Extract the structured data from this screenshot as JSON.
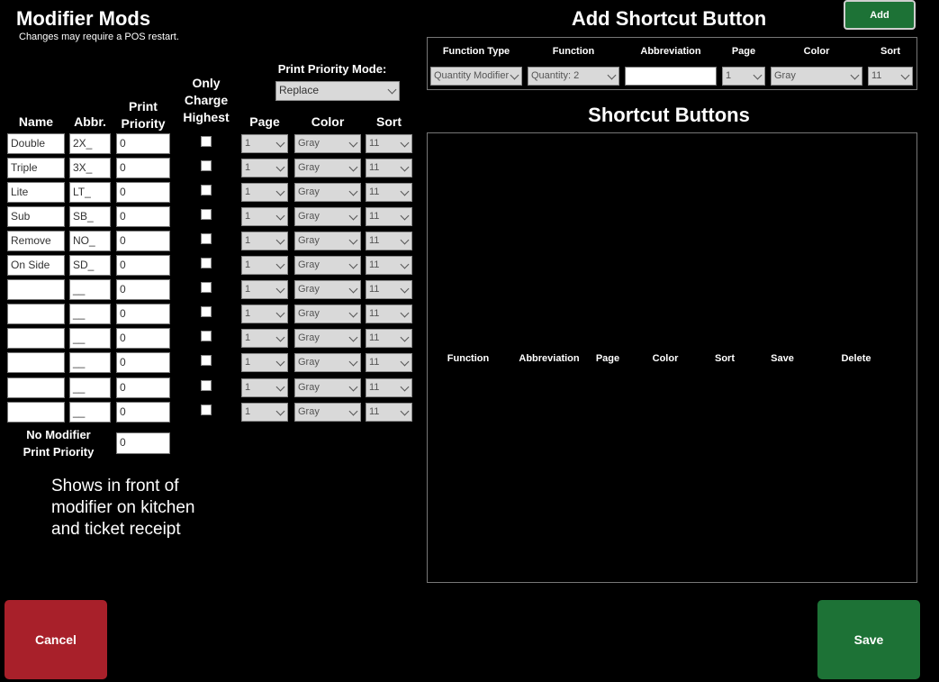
{
  "page": {
    "title": "Modifier Mods",
    "subtitle": "Changes may require a POS restart."
  },
  "mods": {
    "print_priority_mode_label": "Print Priority Mode:",
    "print_priority_mode_value": "Replace",
    "headers": {
      "name": "Name",
      "abbr": "Abbr.",
      "print_priority": "Print Priority",
      "only_charge_highest": "Only Charge Highest",
      "page": "Page",
      "color": "Color",
      "sort": "Sort"
    },
    "rows": [
      {
        "name": "Double",
        "abbr": "2X_",
        "priority": "0",
        "page": "1",
        "color": "Gray",
        "sort": "11"
      },
      {
        "name": "Triple",
        "abbr": "3X_",
        "priority": "0",
        "page": "1",
        "color": "Gray",
        "sort": "11"
      },
      {
        "name": "Lite",
        "abbr": "LT_",
        "priority": "0",
        "page": "1",
        "color": "Gray",
        "sort": "11"
      },
      {
        "name": "Sub",
        "abbr": "SB_",
        "priority": "0",
        "page": "1",
        "color": "Gray",
        "sort": "11"
      },
      {
        "name": "Remove",
        "abbr": "NO_",
        "priority": "0",
        "page": "1",
        "color": "Gray",
        "sort": "11"
      },
      {
        "name": "On Side",
        "abbr": "SD_",
        "priority": "0",
        "page": "1",
        "color": "Gray",
        "sort": "11"
      },
      {
        "name": "",
        "abbr": "__",
        "priority": "0",
        "page": "1",
        "color": "Gray",
        "sort": "11"
      },
      {
        "name": "",
        "abbr": "__",
        "priority": "0",
        "page": "1",
        "color": "Gray",
        "sort": "11"
      },
      {
        "name": "",
        "abbr": "__",
        "priority": "0",
        "page": "1",
        "color": "Gray",
        "sort": "11"
      },
      {
        "name": "",
        "abbr": "__",
        "priority": "0",
        "page": "1",
        "color": "Gray",
        "sort": "11"
      },
      {
        "name": "",
        "abbr": "__",
        "priority": "0",
        "page": "1",
        "color": "Gray",
        "sort": "11"
      },
      {
        "name": "",
        "abbr": "__",
        "priority": "0",
        "page": "1",
        "color": "Gray",
        "sort": "11"
      }
    ],
    "no_modifier_label": "No Modifier Print Priority",
    "no_modifier_value": "0",
    "note": "Shows in front of modifier on kitchen and ticket receipt"
  },
  "add_shortcut": {
    "title": "Add Shortcut Button",
    "add_label": "Add",
    "headers": {
      "function_type": "Function Type",
      "function": "Function",
      "abbreviation": "Abbreviation",
      "page": "Page",
      "color": "Color",
      "sort": "Sort"
    },
    "values": {
      "function_type": "Quantity Modifier",
      "function": "Quantity: 2",
      "abbreviation": "",
      "page": "1",
      "color": "Gray",
      "sort": "11"
    }
  },
  "shortcut_buttons": {
    "title": "Shortcut Buttons",
    "columns": [
      "Function",
      "Abbreviation",
      "Page",
      "Color",
      "Sort",
      "Save",
      "Delete"
    ]
  },
  "footer": {
    "cancel_label": "Cancel",
    "save_label": "Save"
  },
  "colors": {
    "cancel": "#a8202a",
    "save": "#1d7236",
    "add": "#1d7236",
    "background": "#000000"
  }
}
